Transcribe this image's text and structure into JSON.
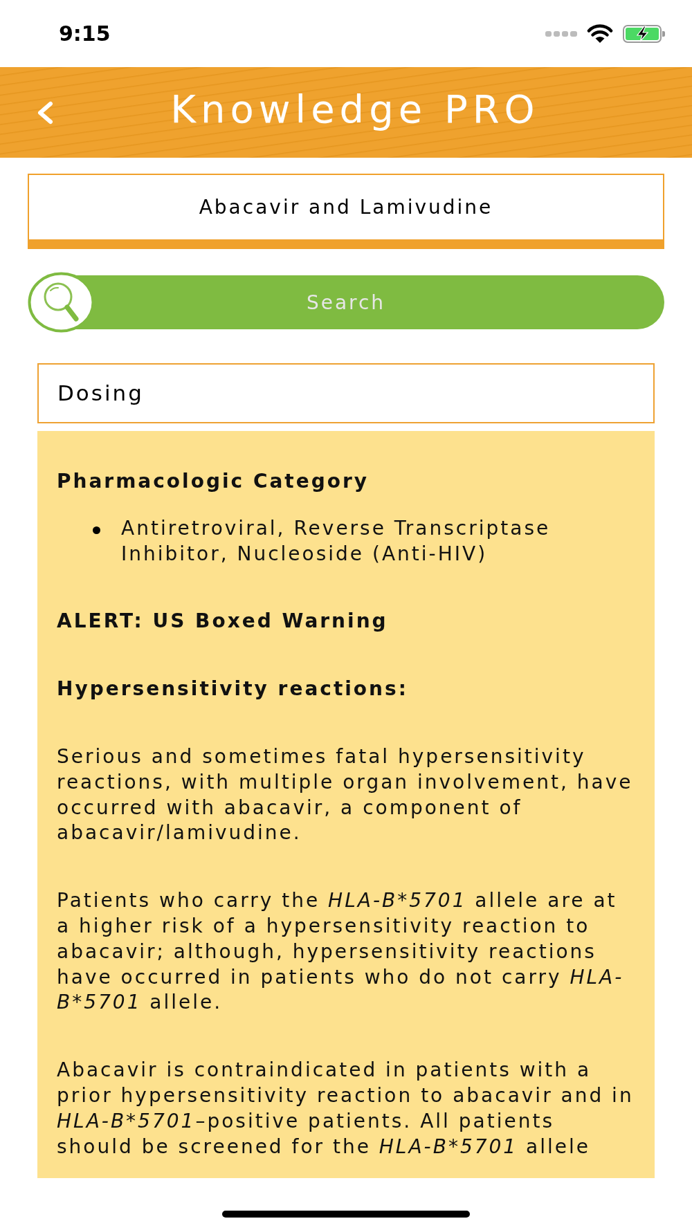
{
  "status_bar": {
    "time": "9:15"
  },
  "header": {
    "title": "Knowledge PRO"
  },
  "drug_selector": {
    "value": "Abacavir and Lamivudine"
  },
  "search": {
    "placeholder": "Search"
  },
  "section_selector": {
    "value": "Dosing"
  },
  "content": [
    {
      "kind": "heading",
      "text": "Pharmacologic Category"
    },
    {
      "kind": "bullets",
      "items": [
        "Antiretroviral, Reverse Transcriptase Inhibitor, Nucleoside (Anti-HIV)"
      ]
    },
    {
      "kind": "heading",
      "text": "ALERT: US Boxed Warning"
    },
    {
      "kind": "heading",
      "text": "Hypersensitivity reactions:"
    },
    {
      "kind": "paragraph",
      "runs": [
        {
          "text": "Serious and sometimes fatal hypersensitivity reactions, with multiple organ involvement, have occurred with abacavir, a component of abacavir/lamivudine.",
          "italic": false
        }
      ]
    },
    {
      "kind": "paragraph",
      "runs": [
        {
          "text": "Patients who carry the ",
          "italic": false
        },
        {
          "text": "HLA-B*5701",
          "italic": true
        },
        {
          "text": " allele are at a higher risk of a hypersensitivity reaction to abacavir; although, hypersensitivity reactions have occurred in patients who do not carry ",
          "italic": false
        },
        {
          "text": "HLA-B*5701",
          "italic": true
        },
        {
          "text": " allele.",
          "italic": false
        }
      ]
    },
    {
      "kind": "paragraph",
      "runs": [
        {
          "text": "Abacavir is contraindicated in patients with a prior hypersensitivity reaction to abacavir and in ",
          "italic": false
        },
        {
          "text": "HLA-B*5701",
          "italic": true
        },
        {
          "text": "–positive patients. All patients should be screened for the ",
          "italic": false
        },
        {
          "text": "HLA-B*5701",
          "italic": true
        },
        {
          "text": " allele",
          "italic": false
        }
      ]
    }
  ]
}
